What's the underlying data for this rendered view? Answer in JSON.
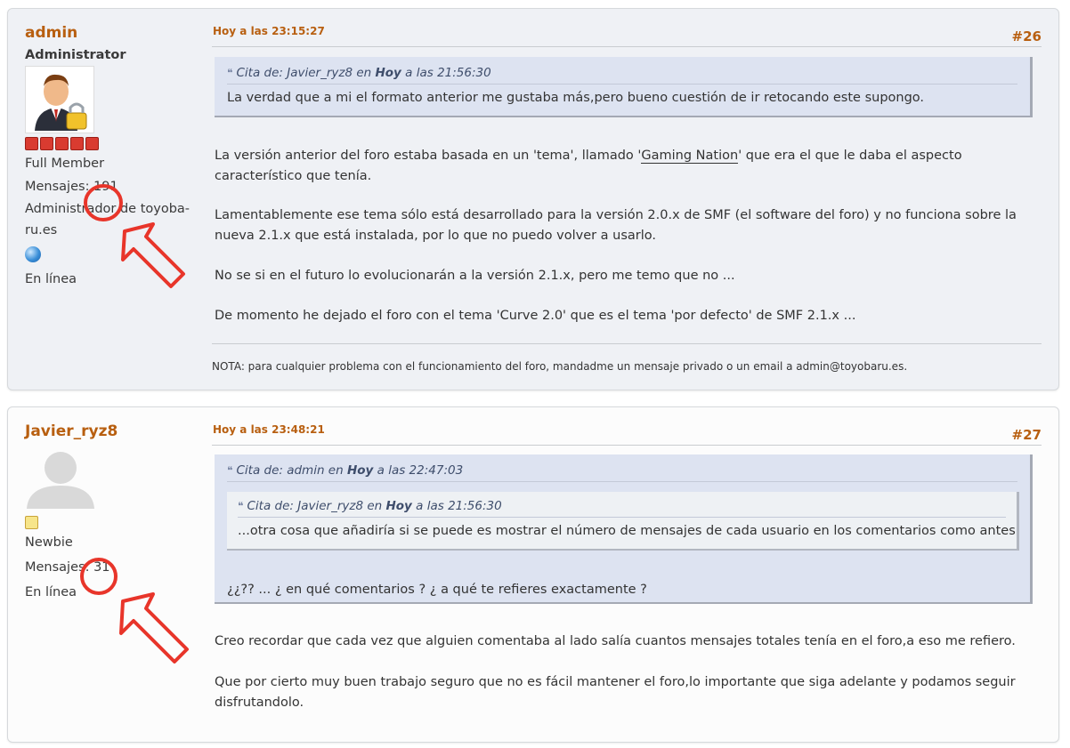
{
  "posts": [
    {
      "username": "admin",
      "group": "Administrator",
      "rank": "Full Member",
      "posts_label": "Mensajes:",
      "posts_count": "191",
      "custom_title": "Administrador de toyobaru.es",
      "custom_title_line1": "Administrador de toyoba-",
      "custom_title_line2": "ru.es",
      "status": "En línea",
      "time": "Hoy a las 23:15:27",
      "number": "#26",
      "quote": {
        "cite_prefix": "Cita de: Javier_ryz8 en",
        "cite_day": "Hoy",
        "cite_time": "a las 21:56:30",
        "text": "La verdad que a mi el formato anterior me gustaba más,pero bueno cuestión de ir retocando este supongo."
      },
      "p1_before": "La versión anterior del foro estaba basada en un 'tema', llamado '",
      "p1_link": "Gaming Nation",
      "p1_after": "' que era el que le daba el aspecto característico que tenía.",
      "p2": "Lamentablemente ese tema sólo está desarrollado para la versión 2.0.x de SMF (el software del foro) y no funciona sobre la nueva 2.1.x que está instalada, por lo que no puedo volver a usarlo.",
      "p3": "No se si en el futuro lo evolucionarán a la versión 2.1.x, pero me temo que no ...",
      "p4": "De momento he dejado el foro con el tema 'Curve 2.0' que es el tema 'por defecto' de SMF 2.1.x ...",
      "signature": "NOTA: para cualquier problema con el funcionamiento del foro, mandadme un mensaje privado o un email a admin@toyobaru.es."
    },
    {
      "username": "Javier_ryz8",
      "rank": "Newbie",
      "posts_label": "Mensajes:",
      "posts_count": "31",
      "status": "En línea",
      "time": "Hoy a las 23:48:21",
      "number": "#27",
      "quote": {
        "cite_prefix": "Cita de: admin en",
        "cite_day": "Hoy",
        "cite_time": "a las 22:47:03",
        "inner": {
          "cite_prefix": "Cita de: Javier_ryz8 en",
          "cite_day": "Hoy",
          "cite_time": "a las 21:56:30",
          "text": "...otra cosa que añadiría si se puede es mostrar el número de mensajes de cada usuario en los comentarios como antes"
        },
        "text": "¿¿?? ... ¿ en qué comentarios ? ¿ a qué te refieres exactamente ?"
      },
      "p1": "Creo recordar que cada vez que alguien comentaba al lado salía cuantos mensajes totales tenía en el foro,a eso me refiero.",
      "p2": "Que por cierto muy buen trabajo seguro que no es fácil mantener el foro,lo importante  que siga adelante y podamos seguir disfrutandolo."
    }
  ],
  "icons": {
    "quote": "quote-icon",
    "admin_avatar": "admin-avatar",
    "default_avatar": "default-avatar",
    "online": "globe-online-icon",
    "annotation": "red-circle-arrow-annotation"
  },
  "colors": {
    "username": "#b85f10",
    "post1_bg": "#eff1f5",
    "post2_bg": "#fcfcfc",
    "quote_bg": "#dde3f1",
    "annotation": "#e8352a"
  }
}
